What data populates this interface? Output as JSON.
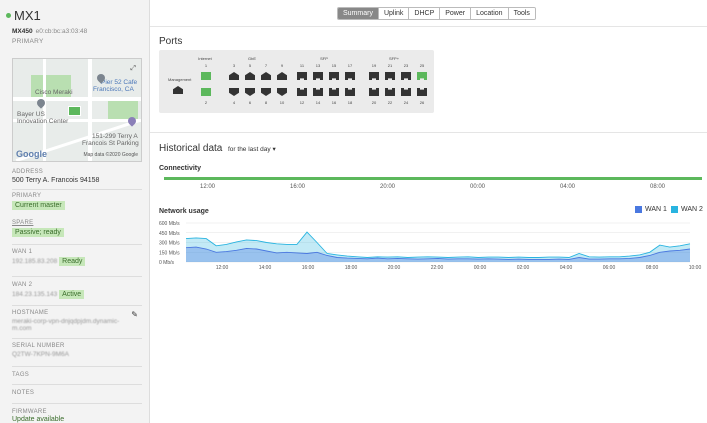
{
  "device": {
    "name": "MX1",
    "model": "MX450",
    "mac": "e0:cb:bc:a3:03:48",
    "role": "PRIMARY"
  },
  "map": {
    "labels": [
      "Cisco Meraki",
      "Bayer US",
      "Innovation Center",
      "Pier 52 Cafe",
      "Francisco, CA",
      "151-299 Terry A",
      "Francois St Parking"
    ],
    "google": "Google",
    "attribution": "Map data ©2020 Google"
  },
  "sidebar": {
    "address_label": "ADDRESS",
    "address_value": "500 Terry A. Francois 94158",
    "primary_label": "PRIMARY",
    "primary_badge": "Current master",
    "spare_label": "SPARE",
    "spare_badge": "Passive; ready",
    "wan1_label": "WAN 1",
    "wan1_ip": "192.185.83.208",
    "wan1_status": "Ready",
    "wan2_label": "WAN 2",
    "wan2_ip": "184.23.135.143",
    "wan2_status": "Active",
    "hostname_label": "HOSTNAME",
    "hostname_line1": "meraki-corp-vpn-dnjqdpjdm.dynamic-",
    "hostname_line2": "m.com",
    "serial_label": "SERIAL NUMBER",
    "serial_value": "Q2TW-7KPN-9M6A",
    "tags_label": "TAGS",
    "notes_label": "NOTES",
    "firmware_label": "FIRMWARE",
    "firmware_value": "Update available"
  },
  "tabs": [
    "Summary",
    "Uplink",
    "DHCP",
    "Power",
    "Location",
    "Tools"
  ],
  "active_tab": "Summary",
  "ports": {
    "title": "Ports",
    "group_labels": {
      "internet": "Internet",
      "gbe": "GbE",
      "sfp": "SFP",
      "sfpplus": "SFP+",
      "management": "Management"
    },
    "top_numbers": [
      "1",
      "3",
      "5",
      "7",
      "9",
      "11",
      "13",
      "15",
      "17",
      "19",
      "21",
      "23",
      "25"
    ],
    "bottom_numbers": [
      "2",
      "4",
      "6",
      "8",
      "10",
      "12",
      "14",
      "16",
      "18",
      "20",
      "22",
      "24",
      "26"
    ]
  },
  "historical": {
    "title": "Historical data",
    "range": "for the last day",
    "connectivity_title": "Connectivity",
    "connectivity_ticks": [
      "12:00",
      "16:00",
      "20:00",
      "00:00",
      "04:00",
      "08:00"
    ],
    "network_title": "Network usage"
  },
  "colors": {
    "green": "#5cb85c",
    "wan1": "#4a78e0",
    "wan2": "#29b4e0"
  },
  "chart_data": {
    "type": "area",
    "title": "Network usage",
    "yticks": [
      "600 Mb/s",
      "450 Mb/s",
      "300 Mb/s",
      "150 Mb/s",
      "0 Mb/s"
    ],
    "ylim": [
      0,
      600
    ],
    "xticks": [
      "12:00",
      "14:00",
      "16:00",
      "18:00",
      "20:00",
      "22:00",
      "00:00",
      "02:00",
      "04:00",
      "06:00",
      "08:00",
      "10:00"
    ],
    "x": [
      0,
      1,
      2,
      3,
      4,
      5,
      6,
      7,
      8,
      9,
      10,
      11,
      12,
      13,
      14,
      15,
      16,
      17,
      18,
      19,
      20,
      21,
      22,
      23,
      24,
      25,
      26,
      27,
      28,
      29,
      30,
      31,
      32,
      33,
      34,
      35,
      36,
      37,
      38,
      39,
      40,
      41,
      42,
      43,
      44,
      45,
      46,
      47,
      48,
      49,
      50
    ],
    "series": [
      {
        "name": "WAN 1",
        "color": "#4a78e0",
        "values": [
          220,
          230,
          200,
          150,
          160,
          180,
          210,
          200,
          170,
          140,
          150,
          140,
          130,
          150,
          100,
          70,
          60,
          55,
          50,
          60,
          50,
          55,
          50,
          45,
          50,
          55,
          45,
          50,
          50,
          45,
          50,
          45,
          40,
          45,
          40,
          40,
          40,
          45,
          40,
          70,
          45,
          45,
          50,
          50,
          55,
          70,
          100,
          150,
          170,
          180,
          200
        ]
      },
      {
        "name": "WAN 2",
        "color": "#29b4e0",
        "values": [
          360,
          370,
          360,
          250,
          270,
          310,
          340,
          330,
          300,
          280,
          270,
          270,
          460,
          300,
          130,
          110,
          90,
          80,
          70,
          80,
          75,
          80,
          70,
          75,
          80,
          75,
          70,
          75,
          80,
          70,
          75,
          75,
          70,
          75,
          70,
          70,
          75,
          75,
          70,
          130,
          80,
          75,
          80,
          80,
          90,
          110,
          150,
          260,
          230,
          250,
          280
        ]
      }
    ],
    "legend": "top-right"
  }
}
